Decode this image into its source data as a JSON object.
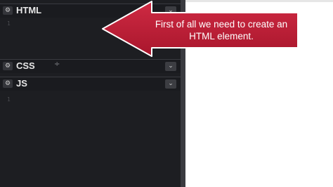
{
  "editor": {
    "panels": [
      {
        "title": "HTML",
        "line_number": "1"
      },
      {
        "title": "CSS",
        "line_number": ""
      },
      {
        "title": "JS",
        "line_number": "1"
      }
    ],
    "gear_glyph": "⚙",
    "chevron_glyph": "⌄",
    "resize_glyph": "÷"
  },
  "callout": {
    "text": "First of all we need to create an HTML element.",
    "color": "#c21f38"
  },
  "colors": {
    "editor_bg": "#1d1e22",
    "header_bg": "#1a1b1f",
    "preview_bg": "#ffffff"
  }
}
